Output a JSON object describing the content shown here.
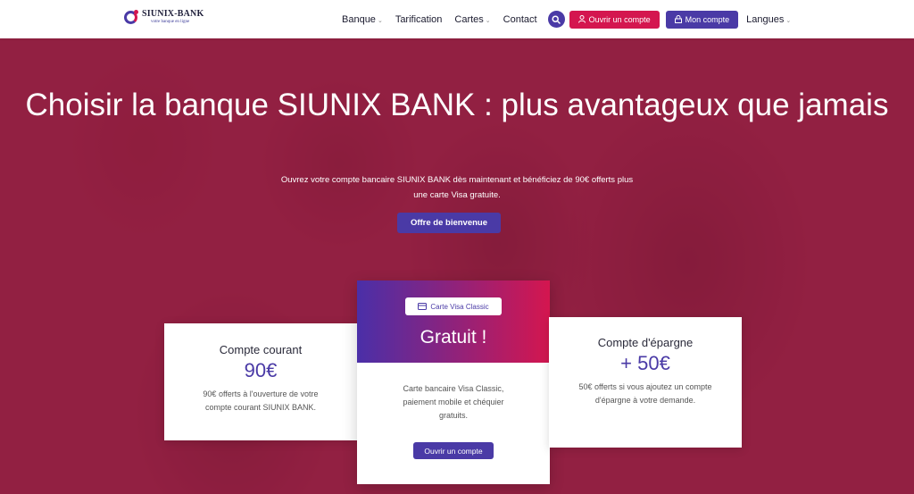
{
  "header": {
    "logo_name": "SIUNIX-BANK",
    "logo_tagline": "votre banque en ligne",
    "nav": [
      {
        "label": "Banque",
        "has_dropdown": true
      },
      {
        "label": "Tarification",
        "has_dropdown": false
      },
      {
        "label": "Cartes",
        "has_dropdown": true
      },
      {
        "label": "Contact",
        "has_dropdown": false
      }
    ],
    "open_account_label": "Ouvrir un compte",
    "my_account_label": "Mon compte",
    "languages_label": "Langues"
  },
  "hero": {
    "title": "Choisir la banque SIUNIX BANK : plus avantageux que jamais",
    "subtitle": "Ouvrez votre compte bancaire SIUNIX BANK dès maintenant et bénéficiez de 90€ offerts plus une carte Visa gratuite.",
    "cta_label": "Offre de bienvenue"
  },
  "offers": {
    "left": {
      "title": "Compte courant",
      "amount": "90€",
      "text": "90€ offerts à l'ouverture de votre compte courant SIUNIX BANK."
    },
    "center": {
      "badge": "Carte Visa Classic",
      "headline": "Gratuit !",
      "text": "Carte bancaire Visa Classic, paiement mobile et chéquier gratuits.",
      "button_label": "Ouvrir un compte"
    },
    "right": {
      "title": "Compte d'épargne",
      "amount": "+ 50€",
      "text": "50€ offerts si vous ajoutez un compte d'épargne à votre demande."
    }
  },
  "colors": {
    "primary": "#4a3aa6",
    "accent": "#d4164f",
    "hero_tint": "#a0264e"
  },
  "icons": {
    "search": "search-icon",
    "user": "user-icon",
    "lock": "lock-icon",
    "card": "credit-card-icon",
    "dropdown": "chevron-down-icon"
  }
}
